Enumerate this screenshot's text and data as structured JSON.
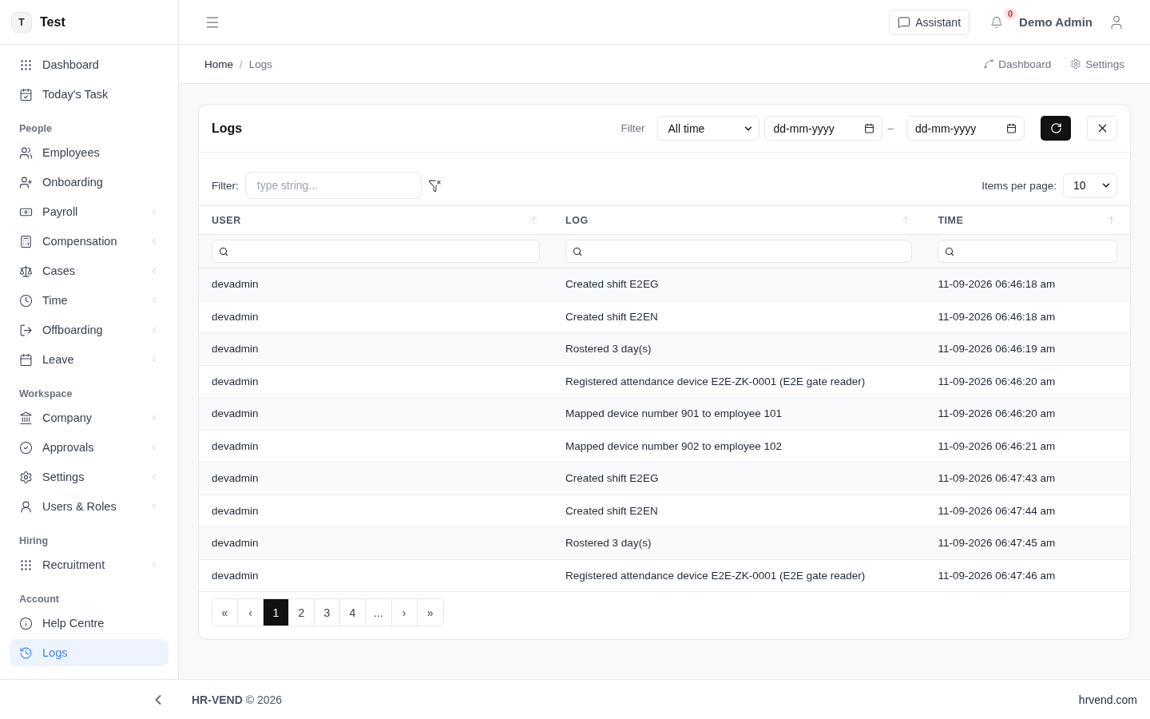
{
  "brand": {
    "initial": "T",
    "name": "Test"
  },
  "sidebar": {
    "top": [
      {
        "label": "Dashboard",
        "selected": false,
        "submenu": false
      },
      {
        "label": "Today's Task",
        "selected": false,
        "submenu": false
      }
    ],
    "groups": [
      {
        "heading": "People",
        "items": [
          {
            "label": "Employees",
            "selected": false,
            "submenu": false
          },
          {
            "label": "Onboarding",
            "selected": false,
            "submenu": false
          },
          {
            "label": "Payroll",
            "selected": false,
            "submenu": true
          },
          {
            "label": "Compensation",
            "selected": false,
            "submenu": true
          },
          {
            "label": "Cases",
            "selected": false,
            "submenu": true
          },
          {
            "label": "Time",
            "selected": false,
            "submenu": true
          },
          {
            "label": "Offboarding",
            "selected": false,
            "submenu": true
          },
          {
            "label": "Leave",
            "selected": false,
            "submenu": true
          }
        ]
      },
      {
        "heading": "Workspace",
        "items": [
          {
            "label": "Company",
            "selected": false,
            "submenu": true
          },
          {
            "label": "Approvals",
            "selected": false,
            "submenu": true
          },
          {
            "label": "Settings",
            "selected": false,
            "submenu": true
          },
          {
            "label": "Users & Roles",
            "selected": false,
            "submenu": true
          }
        ]
      },
      {
        "heading": "Hiring",
        "items": [
          {
            "label": "Recruitment",
            "selected": false,
            "submenu": true
          }
        ]
      },
      {
        "heading": "Account",
        "items": [
          {
            "label": "Help Centre",
            "selected": false,
            "submenu": false
          },
          {
            "label": "Logs",
            "selected": true,
            "submenu": false
          }
        ]
      }
    ]
  },
  "header": {
    "assistant": "Assistant",
    "notifications": "0",
    "user": "Demo Admin"
  },
  "breadcrumb": {
    "separator": "/",
    "items": [
      "Home",
      "Logs"
    ]
  },
  "quick_links": [
    "Dashboard",
    "Settings"
  ],
  "card": {
    "title": "Logs",
    "filter_label": "Filter",
    "range": "All time",
    "date_from": {
      "placeholder": "dd-mm-yyyy"
    },
    "date_to": {
      "placeholder": "dd-mm-yyyy"
    },
    "separator": "–"
  },
  "table_filter": {
    "label": "Filter:",
    "placeholder": "type string..."
  },
  "per_page": {
    "label": "Items per page:",
    "value": "10"
  },
  "table": {
    "columns": [
      "USER",
      "LOG",
      "TIME"
    ],
    "rows": [
      [
        "devadmin",
        "Created shift E2EG",
        "11-09-2026 06:46:18 am"
      ],
      [
        "devadmin",
        "Created shift E2EN",
        "11-09-2026 06:46:18 am"
      ],
      [
        "devadmin",
        "Rostered 3 day(s)",
        "11-09-2026 06:46:19 am"
      ],
      [
        "devadmin",
        "Registered attendance device E2E-ZK-0001 (E2E gate reader)",
        "11-09-2026 06:46:20 am"
      ],
      [
        "devadmin",
        "Mapped device number 901 to employee 101",
        "11-09-2026 06:46:20 am"
      ],
      [
        "devadmin",
        "Mapped device number 902 to employee 102",
        "11-09-2026 06:46:21 am"
      ],
      [
        "devadmin",
        "Created shift E2EG",
        "11-09-2026 06:47:43 am"
      ],
      [
        "devadmin",
        "Created shift E2EN",
        "11-09-2026 06:47:44 am"
      ],
      [
        "devadmin",
        "Rostered 3 day(s)",
        "11-09-2026 06:47:45 am"
      ],
      [
        "devadmin",
        "Registered attendance device E2E-ZK-0001 (E2E gate reader)",
        "11-09-2026 06:47:46 am"
      ]
    ]
  },
  "pagination": [
    {
      "label": "«",
      "selected": false
    },
    {
      "label": "‹",
      "selected": false
    },
    {
      "label": "1",
      "selected": true
    },
    {
      "label": "2",
      "selected": false
    },
    {
      "label": "3",
      "selected": false
    },
    {
      "label": "4",
      "selected": false
    },
    {
      "label": "...",
      "selected": false
    },
    {
      "label": "›",
      "selected": false
    },
    {
      "label": "»",
      "selected": false
    }
  ],
  "footer": {
    "copyright": "**HR-VEND** © 2026",
    "link": "hrvend.com"
  }
}
